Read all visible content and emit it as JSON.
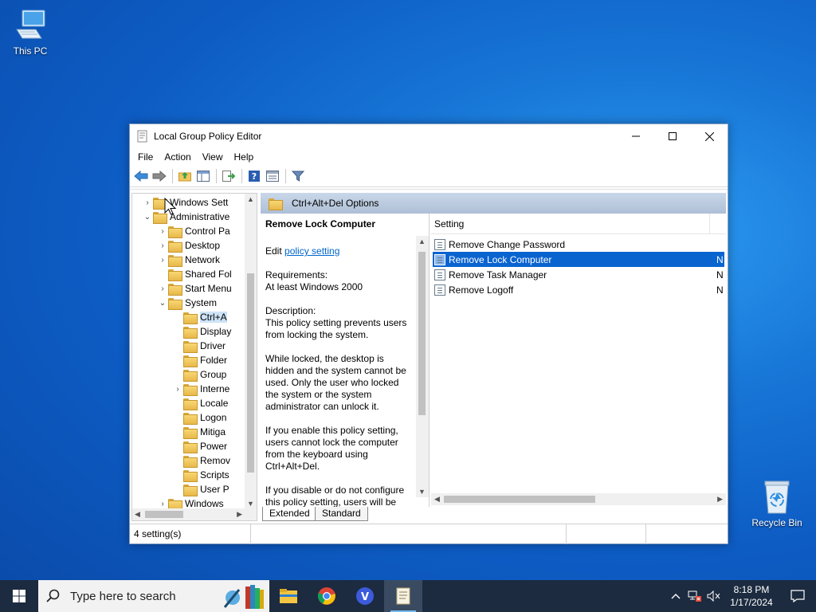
{
  "desktop": {
    "icons": [
      {
        "label": "This PC",
        "icon": "computer-icon"
      },
      {
        "label": "Recycle Bin",
        "icon": "recycle-bin-icon"
      }
    ]
  },
  "window": {
    "title": "Local Group Policy Editor",
    "controls": {
      "minimize": "minimize-icon",
      "maximize": "maximize-icon",
      "close": "close-icon"
    },
    "menu": [
      "File",
      "Action",
      "View",
      "Help"
    ],
    "toolbar": [
      "back-arrow-icon",
      "forward-arrow-icon",
      "up-folder-icon",
      "show-hide-tree-icon",
      "export-list-icon",
      "help-icon",
      "properties-icon",
      "filter-icon"
    ]
  },
  "tree": {
    "items": [
      {
        "label": "Windows Sett",
        "arrow": "›"
      },
      {
        "label": "Administrative",
        "arrow": "⌄"
      },
      {
        "label": "Control Pa",
        "arrow": "›"
      },
      {
        "label": "Desktop",
        "arrow": "›"
      },
      {
        "label": "Network",
        "arrow": "›"
      },
      {
        "label": "Shared Fol",
        "arrow": ""
      },
      {
        "label": "Start Menu",
        "arrow": "›"
      },
      {
        "label": "System",
        "arrow": "⌄"
      },
      {
        "label": "Ctrl+A",
        "arrow": ""
      },
      {
        "label": "Display",
        "arrow": ""
      },
      {
        "label": "Driver",
        "arrow": ""
      },
      {
        "label": "Folder",
        "arrow": ""
      },
      {
        "label": "Group",
        "arrow": ""
      },
      {
        "label": "Interne",
        "arrow": "›"
      },
      {
        "label": "Locale",
        "arrow": ""
      },
      {
        "label": "Logon",
        "arrow": ""
      },
      {
        "label": "Mitiga",
        "arrow": ""
      },
      {
        "label": "Power",
        "arrow": ""
      },
      {
        "label": "Remov",
        "arrow": ""
      },
      {
        "label": "Scripts",
        "arrow": ""
      },
      {
        "label": "User P",
        "arrow": ""
      },
      {
        "label": "Windows",
        "arrow": "›"
      }
    ]
  },
  "rightpane": {
    "header": "Ctrl+Alt+Del Options",
    "description": {
      "title": "Remove Lock Computer",
      "edit_prefix": "Edit ",
      "edit_link": "policy setting ",
      "req_label": "Requirements:",
      "req_value": "At least Windows 2000",
      "desc_label": "Description:",
      "desc_text": "This policy setting prevents users from locking the system.",
      "para2": "While locked, the desktop is hidden and the system cannot be used. Only the user who locked the system or the system administrator can unlock it.",
      "para3": "If you enable this policy setting, users cannot lock the computer from the keyboard using Ctrl+Alt+Del.",
      "para4": "If you disable or do not configure this policy setting, users will be"
    },
    "list": {
      "column": "Setting",
      "rows": [
        {
          "name": "Remove Change Password",
          "state": ""
        },
        {
          "name": "Remove Lock Computer",
          "state": "N"
        },
        {
          "name": "Remove Task Manager",
          "state": "N"
        },
        {
          "name": "Remove Logoff",
          "state": "N"
        }
      ]
    },
    "tabs": [
      "Extended",
      "Standard"
    ]
  },
  "status": {
    "text": "4 setting(s)"
  },
  "taskbar": {
    "search_placeholder": "Type here to search",
    "apps": [
      "file-explorer-icon",
      "chrome-icon",
      "v-app-icon",
      "group-policy-editor-icon"
    ],
    "time": "8:18 PM",
    "date": "1/17/2024"
  }
}
